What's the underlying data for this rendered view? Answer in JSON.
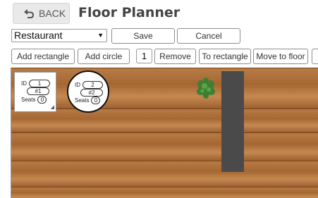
{
  "header": {
    "back_label": "BACK",
    "title": "Floor Planner"
  },
  "toolbar": {
    "floor_select_value": "Restaurant",
    "save_label": "Save",
    "cancel_label": "Cancel",
    "add_rectangle_label": "Add rectangle",
    "add_circle_label": "Add circle",
    "selected_count": "1",
    "remove_label": "Remove",
    "to_rectangle_label": "To rectangle",
    "move_to_floor_label": "Move to floor"
  },
  "tables": [
    {
      "id": "1",
      "name": "#1",
      "seats": "0",
      "shape": "rectangle"
    },
    {
      "id": "2",
      "name": "#2",
      "seats": "0",
      "shape": "circle"
    }
  ],
  "labels": {
    "id": "ID",
    "seats": "Seats"
  },
  "icons": {
    "back": "back-arrow-icon",
    "plant": "plant-icon",
    "resize": "resize-handle-icon"
  }
}
